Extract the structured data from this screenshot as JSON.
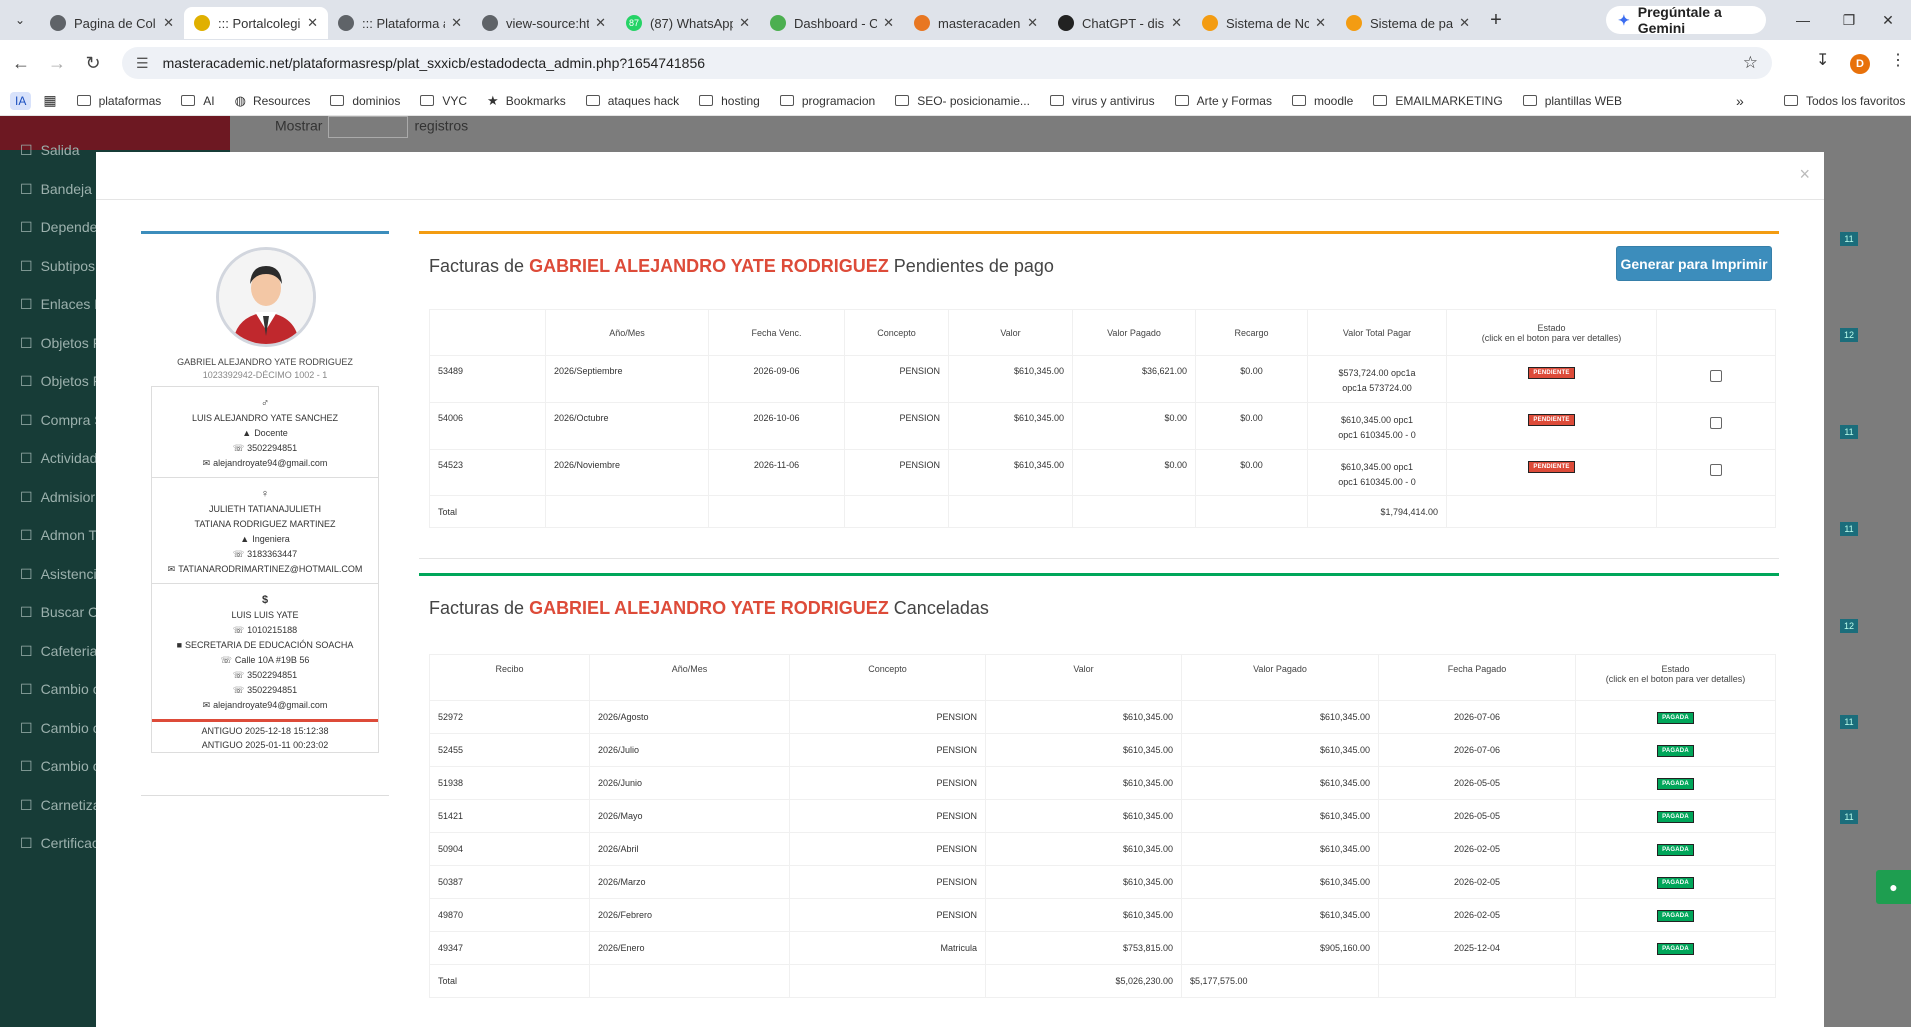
{
  "browser": {
    "tabs": [
      {
        "title": "Pagina de Col",
        "color": "#5f6368"
      },
      {
        "title": "::: Portalcolegi",
        "color": "#e0b000",
        "active": true
      },
      {
        "title": "::: Plataforma a",
        "color": "#5f6368"
      },
      {
        "title": "view-source:ht",
        "color": "#5f6368"
      },
      {
        "title": "(87) WhatsApp",
        "color": "#25d366",
        "fav_text": "87"
      },
      {
        "title": "Dashboard - C",
        "color": "#4caf50"
      },
      {
        "title": "masteracaden",
        "color": "#e87722"
      },
      {
        "title": "ChatGPT - dis",
        "color": "#222222"
      },
      {
        "title": "Sistema de Nc",
        "color": "#f39c12"
      },
      {
        "title": "Sistema de pa",
        "color": "#f39c12"
      }
    ],
    "gemini_label": "Pregúntale a Gemini",
    "url": "masteracademic.net/plataformasresp/plat_sxxicb/estadodecta_admin.php?1654741856",
    "profile_initial": "D",
    "bookmarks_ia": "IA",
    "bookmarks": [
      "plataformas",
      "AI",
      "Resources",
      "dominios",
      "VYC",
      "Bookmarks",
      "ataques hack",
      "hosting",
      "programacion",
      "SEO- posicionamie...",
      "virus y antivirus",
      "Arte y Formas",
      "moodle",
      "EMAILMARKETING",
      "plantillas WEB"
    ],
    "all_bookmarks": "Todos los favoritos"
  },
  "background": {
    "sidebar_items": [
      "Salida",
      "Bandeja",
      "Depende",
      "Subtipos",
      "Enlaces D",
      "Objetos F",
      "Objetos F",
      "Compra S",
      "Actividad",
      "Admisior",
      "Admon Ta",
      "Asistencia",
      "Buscar C",
      "Cafeteria",
      "Cambio c",
      "Cambio c",
      "Cambio c",
      "Carnetiza",
      "Certificac"
    ],
    "mostrar": "Mostrar",
    "registros": "registros",
    "right_badges": [
      "11",
      "12",
      "11",
      "11",
      "12",
      "11",
      "11"
    ]
  },
  "profile": {
    "name": "GABRIEL ALEJANDRO YATE RODRIGUEZ",
    "id_line": "1023392942-DÉCIMO 1002 - 1",
    "contacts": [
      {
        "symbol": "♂",
        "lines": [
          "LUIS ALEJANDRO YATE SANCHEZ",
          "Docente",
          "3502294851",
          "alejandroyate94@gmail.com"
        ]
      },
      {
        "symbol": "♀",
        "lines": [
          "JULIETH TATIANAJULIETH",
          "TATIANA RODRIGUEZ MARTINEZ",
          "Ingeniera",
          "3183363447",
          "TATIANARODRIMARTINEZ@HOTMAIL.COM"
        ]
      },
      {
        "symbol": "$",
        "lines": [
          "LUIS LUIS  YATE",
          "1010215188",
          "SECRETARIA DE EDUCACIÓN SOACHA",
          "Calle 10A #19B 56",
          "3502294851",
          "3502294851",
          "alejandroyate94@gmail.com"
        ]
      }
    ],
    "antiguo": [
      "ANTIGUO 2025-12-18 15:12:38",
      "ANTIGUO 2025-01-11 00:23:02"
    ]
  },
  "pending": {
    "title_prefix": "Facturas de",
    "student": "GABRIEL ALEJANDRO YATE RODRIGUEZ",
    "title_suffix": "Pendientes de pago",
    "print_button": "Generar para Imprimir",
    "headers": [
      "",
      "Año/Mes",
      "Fecha Venc.",
      "Concepto",
      "Valor",
      "Valor Pagado",
      "Recargo",
      "Valor Total Pagar",
      "Estado",
      ""
    ],
    "estado_note": "(click en el boton para ver detalles)",
    "rows": [
      {
        "id": "53489",
        "mes": "2026/Septiembre",
        "venc": "2026-09-06",
        "concepto": "PENSION",
        "valor": "$610,345.00",
        "pagado": "$36,621.00",
        "recargo": "$0.00",
        "total1": "$573,724.00 opc1a",
        "total2": "opc1a 573724.00",
        "estado": "PENDIENTE"
      },
      {
        "id": "54006",
        "mes": "2026/Octubre",
        "venc": "2026-10-06",
        "concepto": "PENSION",
        "valor": "$610,345.00",
        "pagado": "$0.00",
        "recargo": "$0.00",
        "total1": "$610,345.00 opc1",
        "total2": "opc1 610345.00 - 0",
        "estado": "PENDIENTE"
      },
      {
        "id": "54523",
        "mes": "2026/Noviembre",
        "venc": "2026-11-06",
        "concepto": "PENSION",
        "valor": "$610,345.00",
        "pagado": "$0.00",
        "recargo": "$0.00",
        "total1": "$610,345.00 opc1",
        "total2": "opc1 610345.00 - 0",
        "estado": "PENDIENTE"
      }
    ],
    "total_label": "Total",
    "total_value": "$1,794,414.00"
  },
  "cancelled": {
    "title_prefix": "Facturas de",
    "student": "GABRIEL ALEJANDRO YATE RODRIGUEZ",
    "title_suffix": "Canceladas",
    "headers": [
      "Recibo",
      "Año/Mes",
      "Concepto",
      "Valor",
      "Valor Pagado",
      "Fecha Pagado",
      "Estado"
    ],
    "estado_note": "(click en el boton para ver detalles)",
    "rows": [
      {
        "recibo": "52972",
        "mes": "2026/Agosto",
        "concepto": "PENSION",
        "valor": "$610,345.00",
        "pagado": "$610,345.00",
        "fecha": "2026-07-06",
        "estado": "PAGADA"
      },
      {
        "recibo": "52455",
        "mes": "2026/Julio",
        "concepto": "PENSION",
        "valor": "$610,345.00",
        "pagado": "$610,345.00",
        "fecha": "2026-07-06",
        "estado": "PAGADA"
      },
      {
        "recibo": "51938",
        "mes": "2026/Junio",
        "concepto": "PENSION",
        "valor": "$610,345.00",
        "pagado": "$610,345.00",
        "fecha": "2026-05-05",
        "estado": "PAGADA"
      },
      {
        "recibo": "51421",
        "mes": "2026/Mayo",
        "concepto": "PENSION",
        "valor": "$610,345.00",
        "pagado": "$610,345.00",
        "fecha": "2026-05-05",
        "estado": "PAGADA"
      },
      {
        "recibo": "50904",
        "mes": "2026/Abril",
        "concepto": "PENSION",
        "valor": "$610,345.00",
        "pagado": "$610,345.00",
        "fecha": "2026-02-05",
        "estado": "PAGADA"
      },
      {
        "recibo": "50387",
        "mes": "2026/Marzo",
        "concepto": "PENSION",
        "valor": "$610,345.00",
        "pagado": "$610,345.00",
        "fecha": "2026-02-05",
        "estado": "PAGADA"
      },
      {
        "recibo": "49870",
        "mes": "2026/Febrero",
        "concepto": "PENSION",
        "valor": "$610,345.00",
        "pagado": "$610,345.00",
        "fecha": "2026-02-05",
        "estado": "PAGADA"
      },
      {
        "recibo": "49347",
        "mes": "2026/Enero",
        "concepto": "Matricula",
        "valor": "$753,815.00",
        "pagado": "$905,160.00",
        "fecha": "2025-12-04",
        "estado": "PAGADA"
      }
    ],
    "total_label": "Total",
    "total_valor": "$5,026,230.00",
    "total_pagado": "$5,177,575.00"
  }
}
